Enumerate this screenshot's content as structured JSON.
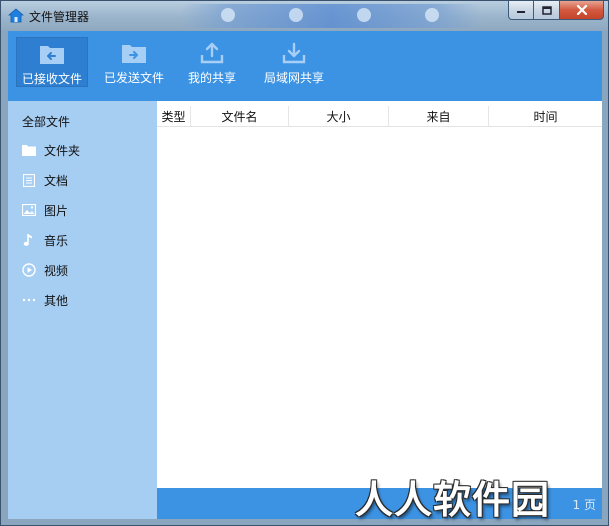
{
  "window": {
    "title": "文件管理器",
    "icon": "home-icon",
    "controls": [
      "minimize-icon",
      "maximize-icon",
      "close-icon"
    ]
  },
  "toolbar": {
    "items": [
      {
        "label": "已接收文件",
        "icon": "folder-in-icon",
        "active": true
      },
      {
        "label": "已发送文件",
        "icon": "folder-out-icon",
        "active": false
      },
      {
        "label": "我的共享",
        "icon": "upload-icon",
        "active": false
      },
      {
        "label": "局域网共享",
        "icon": "download-icon",
        "active": false
      }
    ]
  },
  "sidebar": {
    "header": "全部文件",
    "items": [
      {
        "label": "文件夹",
        "icon": "folder-icon"
      },
      {
        "label": "文档",
        "icon": "document-icon"
      },
      {
        "label": "图片",
        "icon": "image-icon"
      },
      {
        "label": "音乐",
        "icon": "music-icon"
      },
      {
        "label": "视频",
        "icon": "video-icon"
      },
      {
        "label": "其他",
        "icon": "more-icon"
      }
    ]
  },
  "table": {
    "columns": [
      "类型",
      "文件名",
      "大小",
      "来自",
      "时间"
    ],
    "rows": []
  },
  "footer": {
    "page_text": "1 页"
  },
  "watermark": "人人软件园",
  "colors": {
    "accent": "#3d93e3",
    "sidebar": "#a6cdf2",
    "active_tab": "#2e7fd1"
  }
}
